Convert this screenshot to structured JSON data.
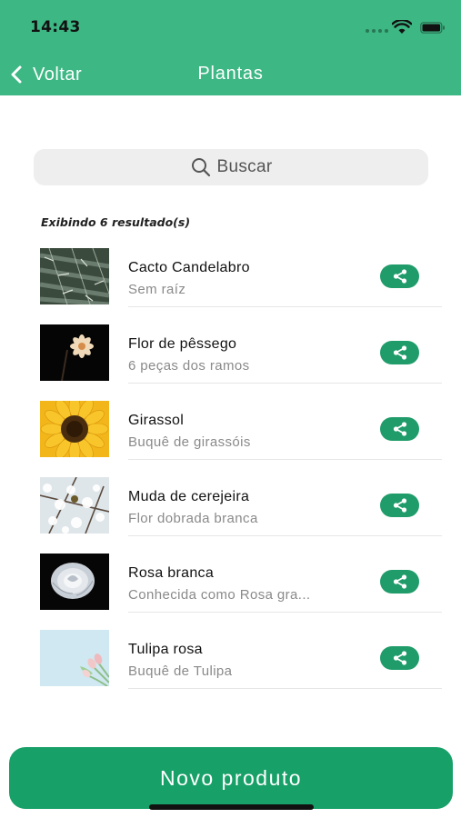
{
  "status_bar": {
    "time": "14:43"
  },
  "nav": {
    "back_label": "Voltar",
    "title": "Plantas"
  },
  "search": {
    "placeholder": "Buscar"
  },
  "results_text": "Exibindo 6 resultado(s)",
  "items": [
    {
      "name": "Cacto Candelabro",
      "description": "Sem raíz",
      "thumb": "cactus-photo"
    },
    {
      "name": "Flor de pêssego",
      "description": "6 peças dos ramos",
      "thumb": "peach-flower-photo"
    },
    {
      "name": "Girassol",
      "description": "Buquê de girassóis",
      "thumb": "sunflower-photo"
    },
    {
      "name": "Muda de cerejeira",
      "description": "Flor dobrada branca",
      "thumb": "cherry-blossom-photo"
    },
    {
      "name": "Rosa branca",
      "description": "Conhecida como Rosa gra...",
      "thumb": "white-rose-photo"
    },
    {
      "name": "Tulipa rosa",
      "description": "Buquê de Tulipa",
      "thumb": "pink-tulip-photo"
    }
  ],
  "cta": {
    "label": "Novo produto"
  },
  "colors": {
    "header": "#3db783",
    "accent": "#1f9c6a",
    "cta": "#17a067"
  }
}
